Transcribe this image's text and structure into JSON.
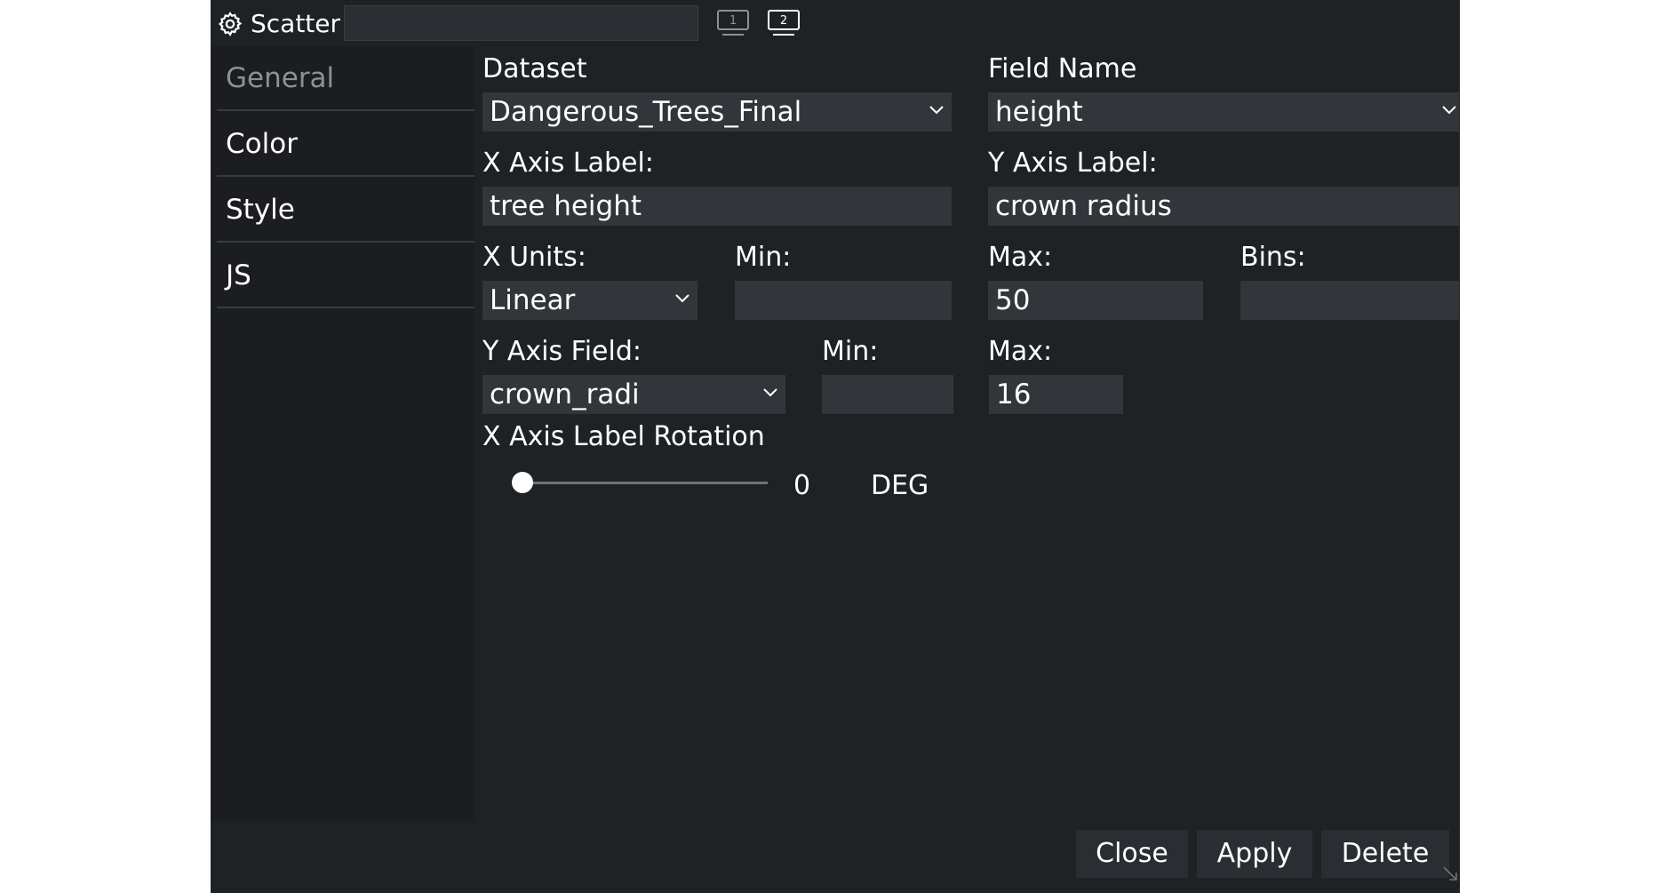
{
  "window": {
    "title": "Scatter",
    "title_input_value": "",
    "icons": [
      "gear-icon",
      "screen-1-icon",
      "screen-2-icon",
      "resize-handle-icon"
    ]
  },
  "screen_buttons": [
    {
      "label": "1"
    },
    {
      "label": "2"
    }
  ],
  "sidebar": {
    "items": [
      {
        "label": "General",
        "active": true
      },
      {
        "label": "Color"
      },
      {
        "label": "Style"
      },
      {
        "label": "JS"
      }
    ]
  },
  "form": {
    "dataset": {
      "label": "Dataset",
      "value": "Dangerous_Trees_Final"
    },
    "field_name": {
      "label": "Field Name",
      "value": "height"
    },
    "x_axis_label": {
      "label": "X Axis Label:",
      "value": "tree height"
    },
    "y_axis_label": {
      "label": "Y Axis Label:",
      "value": "crown radius"
    },
    "x_units": {
      "label": "X Units:",
      "value": "Linear"
    },
    "x_min": {
      "label": "Min:",
      "value": ""
    },
    "x_max": {
      "label": "Max:",
      "value": "50"
    },
    "bins": {
      "label": "Bins:",
      "value": ""
    },
    "y_axis_field": {
      "label": "Y Axis Field:",
      "value": "crown_radi"
    },
    "y_min": {
      "label": "Min:",
      "value": ""
    },
    "y_max": {
      "label": "Max:",
      "value": "16"
    },
    "rotation": {
      "label": "X Axis Label Rotation",
      "value": "0",
      "unit": "DEG"
    }
  },
  "buttons": {
    "close": "Close",
    "apply": "Apply",
    "delete": "Delete"
  },
  "colors": {
    "dialog_bg": "#1f2225",
    "sidebar_bg": "#1b1d20",
    "field_bg": "#32363b",
    "button_bg": "#2a2d31",
    "text": "#ffffff",
    "muted_text": "#8d9196"
  }
}
